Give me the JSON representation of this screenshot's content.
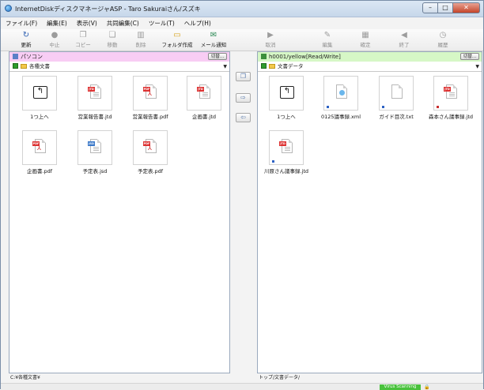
{
  "window": {
    "title": "InternetDiskディスクマネージャASP - Taro Sakuraiさん/スズキ"
  },
  "menu": [
    "ファイル(F)",
    "編集(E)",
    "表示(V)",
    "共同編集(C)",
    "ツール(T)",
    "ヘルプ(H)"
  ],
  "toolbar": {
    "refresh": "更新",
    "stop": "中止",
    "copy": "コピー",
    "move": "移動",
    "delete": "削除",
    "new_folder": "フォルダ作成",
    "mail": "メール通知",
    "cancel": "取消",
    "edit": "編集",
    "confirm": "確定",
    "end": "終了",
    "history": "履歴"
  },
  "left_pane": {
    "header": "パソコン",
    "cut_label": "切替...",
    "location": "各種文書",
    "status": "C:¥各種文書¥",
    "items": [
      {
        "name": "1つ上へ",
        "kind": "up"
      },
      {
        "name": "営業報告書.jtd",
        "kind": "jtd"
      },
      {
        "name": "営業報告書.pdf",
        "kind": "pdf"
      },
      {
        "name": "企画書.jtd",
        "kind": "jtd"
      },
      {
        "name": "企画書.pdf",
        "kind": "pdf"
      },
      {
        "name": "予定表.jsd",
        "kind": "jsd"
      },
      {
        "name": "予定表.pdf",
        "kind": "pdf"
      }
    ]
  },
  "right_pane": {
    "header": "h0001/yellow[Read/Write]",
    "cut_label": "切替...",
    "location": "文書データ",
    "status": "トップ/文書データ/",
    "items": [
      {
        "name": "1つ上へ",
        "kind": "up"
      },
      {
        "name": "0125議事録.xml",
        "kind": "xml"
      },
      {
        "name": "ガイド目次.txt",
        "kind": "txt"
      },
      {
        "name": "森本さん議事録.jtd",
        "kind": "jtd"
      },
      {
        "name": "川原さん議事録.jtd",
        "kind": "jtd"
      }
    ]
  },
  "statusbar": {
    "virus_label": "Virus Scanning"
  },
  "colors": {
    "left_header": "#f8cdf4",
    "right_header": "#d6f7c6",
    "pdf_red": "#d33333",
    "virus_green": "#49c23c"
  }
}
